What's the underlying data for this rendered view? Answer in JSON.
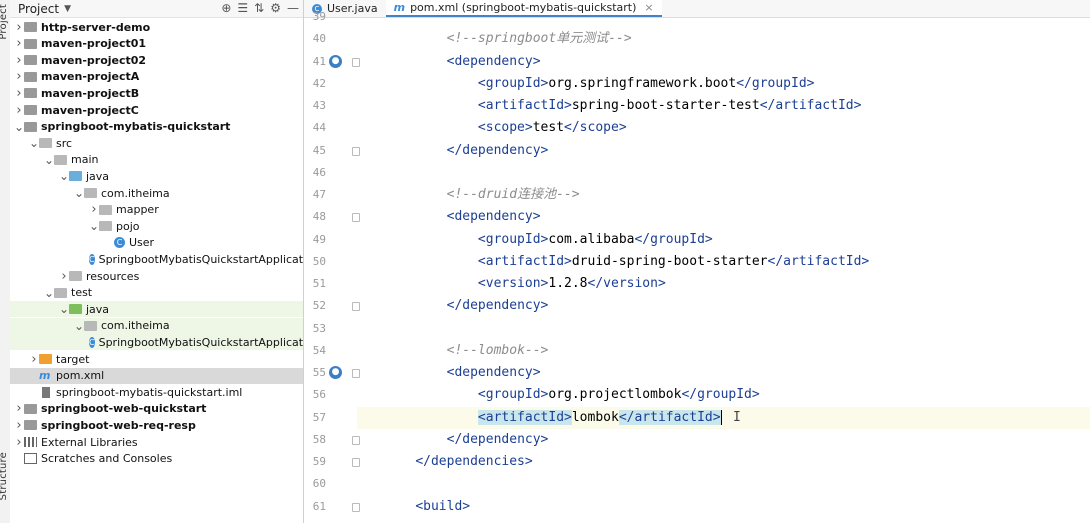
{
  "side_stripe": {
    "top_label": "Project",
    "bottom_label": "Structure"
  },
  "project_panel": {
    "title": "Project",
    "tools": [
      "⊕",
      "☰",
      "⇅",
      "⚙",
      "—"
    ]
  },
  "tree": [
    {
      "depth": 0,
      "arrow": ">",
      "icon": "folder-dark",
      "label": "http-server-demo",
      "bold": true
    },
    {
      "depth": 0,
      "arrow": ">",
      "icon": "folder-dark",
      "label": "maven-project01",
      "bold": true
    },
    {
      "depth": 0,
      "arrow": ">",
      "icon": "folder-dark",
      "label": "maven-project02",
      "bold": true
    },
    {
      "depth": 0,
      "arrow": ">",
      "icon": "folder-dark",
      "label": "maven-projectA",
      "bold": true
    },
    {
      "depth": 0,
      "arrow": ">",
      "icon": "folder-dark",
      "label": "maven-projectB",
      "bold": true
    },
    {
      "depth": 0,
      "arrow": ">",
      "icon": "folder-dark",
      "label": "maven-projectC",
      "bold": true
    },
    {
      "depth": 0,
      "arrow": "v",
      "icon": "folder-dark",
      "label": "springboot-mybatis-quickstart",
      "bold": true
    },
    {
      "depth": 1,
      "arrow": "v",
      "icon": "folder",
      "label": "src"
    },
    {
      "depth": 2,
      "arrow": "v",
      "icon": "folder",
      "label": "main"
    },
    {
      "depth": 3,
      "arrow": "v",
      "icon": "folder-blue",
      "label": "java"
    },
    {
      "depth": 4,
      "arrow": "v",
      "icon": "folder",
      "label": "com.itheima"
    },
    {
      "depth": 5,
      "arrow": ">",
      "icon": "folder",
      "label": "mapper"
    },
    {
      "depth": 5,
      "arrow": "v",
      "icon": "folder",
      "label": "pojo"
    },
    {
      "depth": 6,
      "arrow": "",
      "icon": "class",
      "label": "User"
    },
    {
      "depth": 5,
      "arrow": "",
      "icon": "class",
      "label": "SpringbootMybatisQuickstartApplicat"
    },
    {
      "depth": 3,
      "arrow": ">",
      "icon": "folder",
      "label": "resources"
    },
    {
      "depth": 2,
      "arrow": "v",
      "icon": "folder",
      "label": "test"
    },
    {
      "depth": 3,
      "arrow": "v",
      "icon": "folder-green",
      "label": "java",
      "hl": "green"
    },
    {
      "depth": 4,
      "arrow": "v",
      "icon": "folder",
      "label": "com.itheima",
      "hl": "green"
    },
    {
      "depth": 5,
      "arrow": "",
      "icon": "class",
      "label": "SpringbootMybatisQuickstartApplicat",
      "hl": "green"
    },
    {
      "depth": 1,
      "arrow": ">",
      "icon": "folder-orange",
      "label": "target"
    },
    {
      "depth": 1,
      "arrow": "",
      "icon": "maven",
      "label": "pom.xml",
      "hl": "sel"
    },
    {
      "depth": 1,
      "arrow": "",
      "icon": "iml",
      "label": "springboot-mybatis-quickstart.iml"
    },
    {
      "depth": 0,
      "arrow": ">",
      "icon": "folder-dark",
      "label": "springboot-web-quickstart",
      "bold": true
    },
    {
      "depth": 0,
      "arrow": ">",
      "icon": "folder-dark",
      "label": "springboot-web-req-resp",
      "bold": true
    },
    {
      "depth": 0,
      "arrow": ">",
      "icon": "libs",
      "label": "External Libraries"
    },
    {
      "depth": 0,
      "arrow": "",
      "icon": "scratch",
      "label": "Scratches and Consoles"
    }
  ],
  "tabs": [
    {
      "label": "User.java",
      "icon": "class-icon",
      "active": false
    },
    {
      "label": "pom.xml (springboot-mybatis-quickstart)",
      "icon": "maven-icon",
      "active": true,
      "close": "×"
    }
  ],
  "editor": {
    "first_line_number": 39,
    "lines": [
      {
        "n": "39",
        "tokens": []
      },
      {
        "n": "40",
        "indent": "        ",
        "tokens": [
          [
            "cmt",
            "<!--springboot单元测试-->"
          ]
        ]
      },
      {
        "n": "41",
        "indent": "        ",
        "gutter": "o",
        "fold": true,
        "tokens": [
          [
            "tag",
            "<dependency>"
          ]
        ]
      },
      {
        "n": "42",
        "indent": "            ",
        "tokens": [
          [
            "tag",
            "<groupId>"
          ],
          [
            "txt",
            "org.springframework.boot"
          ],
          [
            "tag",
            "</groupId>"
          ]
        ]
      },
      {
        "n": "43",
        "indent": "            ",
        "tokens": [
          [
            "tag",
            "<artifactId>"
          ],
          [
            "txt",
            "spring-boot-starter-test"
          ],
          [
            "tag",
            "</artifactId>"
          ]
        ]
      },
      {
        "n": "44",
        "indent": "            ",
        "tokens": [
          [
            "tag",
            "<scope>"
          ],
          [
            "txt",
            "test"
          ],
          [
            "tag",
            "</scope>"
          ]
        ]
      },
      {
        "n": "45",
        "indent": "        ",
        "fold": true,
        "tokens": [
          [
            "tag",
            "</dependency>"
          ]
        ]
      },
      {
        "n": "46",
        "tokens": []
      },
      {
        "n": "47",
        "indent": "        ",
        "tokens": [
          [
            "cmt",
            "<!--druid连接池-->"
          ]
        ]
      },
      {
        "n": "48",
        "indent": "        ",
        "fold": true,
        "tokens": [
          [
            "tag",
            "<dependency>"
          ]
        ]
      },
      {
        "n": "49",
        "indent": "            ",
        "tokens": [
          [
            "tag",
            "<groupId>"
          ],
          [
            "txt",
            "com.alibaba"
          ],
          [
            "tag",
            "</groupId>"
          ]
        ]
      },
      {
        "n": "50",
        "indent": "            ",
        "tokens": [
          [
            "tag",
            "<artifactId>"
          ],
          [
            "txt",
            "druid-spring-boot-starter"
          ],
          [
            "tag",
            "</artifactId>"
          ]
        ]
      },
      {
        "n": "51",
        "indent": "            ",
        "tokens": [
          [
            "tag",
            "<version>"
          ],
          [
            "txt",
            "1.2.8"
          ],
          [
            "tag",
            "</version>"
          ]
        ]
      },
      {
        "n": "52",
        "indent": "        ",
        "fold": true,
        "tokens": [
          [
            "tag",
            "</dependency>"
          ]
        ]
      },
      {
        "n": "53",
        "tokens": []
      },
      {
        "n": "54",
        "indent": "        ",
        "tokens": [
          [
            "cmt",
            "<!--lombok-->"
          ]
        ]
      },
      {
        "n": "55",
        "indent": "        ",
        "gutter": "o",
        "fold": true,
        "tokens": [
          [
            "tag",
            "<dependency>"
          ]
        ]
      },
      {
        "n": "56",
        "indent": "            ",
        "tokens": [
          [
            "tag",
            "<groupId>"
          ],
          [
            "txt",
            "org.projectlombok"
          ],
          [
            "tag",
            "</groupId>"
          ]
        ]
      },
      {
        "n": "57",
        "indent": "            ",
        "current": true,
        "tokens": [
          [
            "sel",
            "<artifactId>"
          ],
          [
            "txt",
            "lombok"
          ],
          [
            "sel",
            "</artifactId>"
          ],
          [
            "caret",
            ""
          ]
        ]
      },
      {
        "n": "58",
        "indent": "        ",
        "fold": true,
        "tokens": [
          [
            "tag",
            "</dependency>"
          ]
        ]
      },
      {
        "n": "59",
        "indent": "    ",
        "fold": true,
        "tokens": [
          [
            "tag",
            "</dependencies>"
          ]
        ]
      },
      {
        "n": "60",
        "tokens": []
      },
      {
        "n": "61",
        "indent": "    ",
        "fold": true,
        "tokens": [
          [
            "tag",
            "<build>"
          ]
        ]
      }
    ]
  }
}
